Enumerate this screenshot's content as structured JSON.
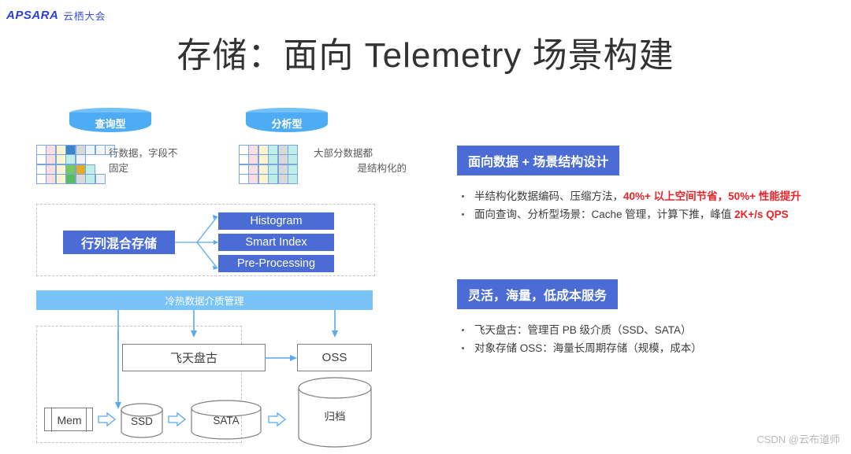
{
  "brand": {
    "mark": "APSARA",
    "cn": "云栖大会"
  },
  "title": "存储：面向 Telemetry 场景构建",
  "left": {
    "cylinders": [
      {
        "label": "查询型"
      },
      {
        "label": "分析型"
      }
    ],
    "captions": [
      "行数据，字段不\n固定",
      "大部分数据都\n是结构化的"
    ],
    "caption_query_line1": "行数据，字段不",
    "caption_query_line2": "固定",
    "caption_analysis_line1": "大部分数据都",
    "caption_analysis_line2": "是结构化的",
    "storage_box": "行列混合存储",
    "features": [
      "Histogram",
      "Smart Index",
      "Pre-Processing"
    ],
    "media_bar": "冷热数据介质管理",
    "pangu": "飞天盘古",
    "oss": "OSS",
    "archive": "归档",
    "tiers": [
      "Mem",
      "SSD",
      "SATA"
    ]
  },
  "right": {
    "section1": {
      "heading": "面向数据 + 场景结构设计",
      "bullets": [
        {
          "parts": [
            {
              "t": "半结构化数据编码、压缩方法，",
              "hl": false
            },
            {
              "t": "40%+ 以上空间节省，50%+ 性能提升",
              "hl": true
            }
          ]
        },
        {
          "parts": [
            {
              "t": "面向查询、分析型场景：Cache 管理，计算下推，峰值 ",
              "hl": false
            },
            {
              "t": "2K+/s QPS",
              "hl": true
            }
          ]
        }
      ]
    },
    "section2": {
      "heading": "灵活，海量，低成本服务",
      "bullets": [
        {
          "parts": [
            {
              "t": "飞天盘古：管理百 PB 级介质（SSD、SATA）",
              "hl": false
            }
          ]
        },
        {
          "parts": [
            {
              "t": "对象存储 OSS：海量长周期存储（规模，成本）",
              "hl": false
            }
          ]
        }
      ]
    }
  },
  "watermark": "CSDN @云布道师",
  "colors": {
    "brand_blue": "#3b51d6",
    "box_blue": "#4a6cd4",
    "cyl_blue": "#4eacf4",
    "bar_blue": "#79c3f7",
    "accent_red": "#e8242a",
    "arrow_blue": "#5aa9ee",
    "grid_border": "#7aa6dd"
  },
  "grids": {
    "query": [
      [
        "#ffffff",
        "#fadce3",
        "#fdf3cf",
        "#3a84c9",
        "#d9d9d9",
        "#eef3f8",
        "#f3f7fb",
        "#eef3f8"
      ],
      [
        "#ffffff",
        "#fadce3",
        "#fdf3cf",
        "#bfeee8",
        "#eef3f8"
      ],
      [
        "#ffffff",
        "#fadce3",
        "#fdf3cf",
        "#74c95f",
        "#e5ac2c",
        "#bfeee8"
      ],
      [
        "#ffffff",
        "#fadce3",
        "#fdf3cf",
        "#58bb61",
        "#d9d9d9",
        "#bfeee8",
        "#eef3f8"
      ]
    ],
    "analysis_columns": [
      "#ffffff",
      "#fadce3",
      "#fdf3cf",
      "#bfeee8",
      "#d9d9d9",
      "#bfeee8"
    ],
    "analysis_rows": 4
  }
}
